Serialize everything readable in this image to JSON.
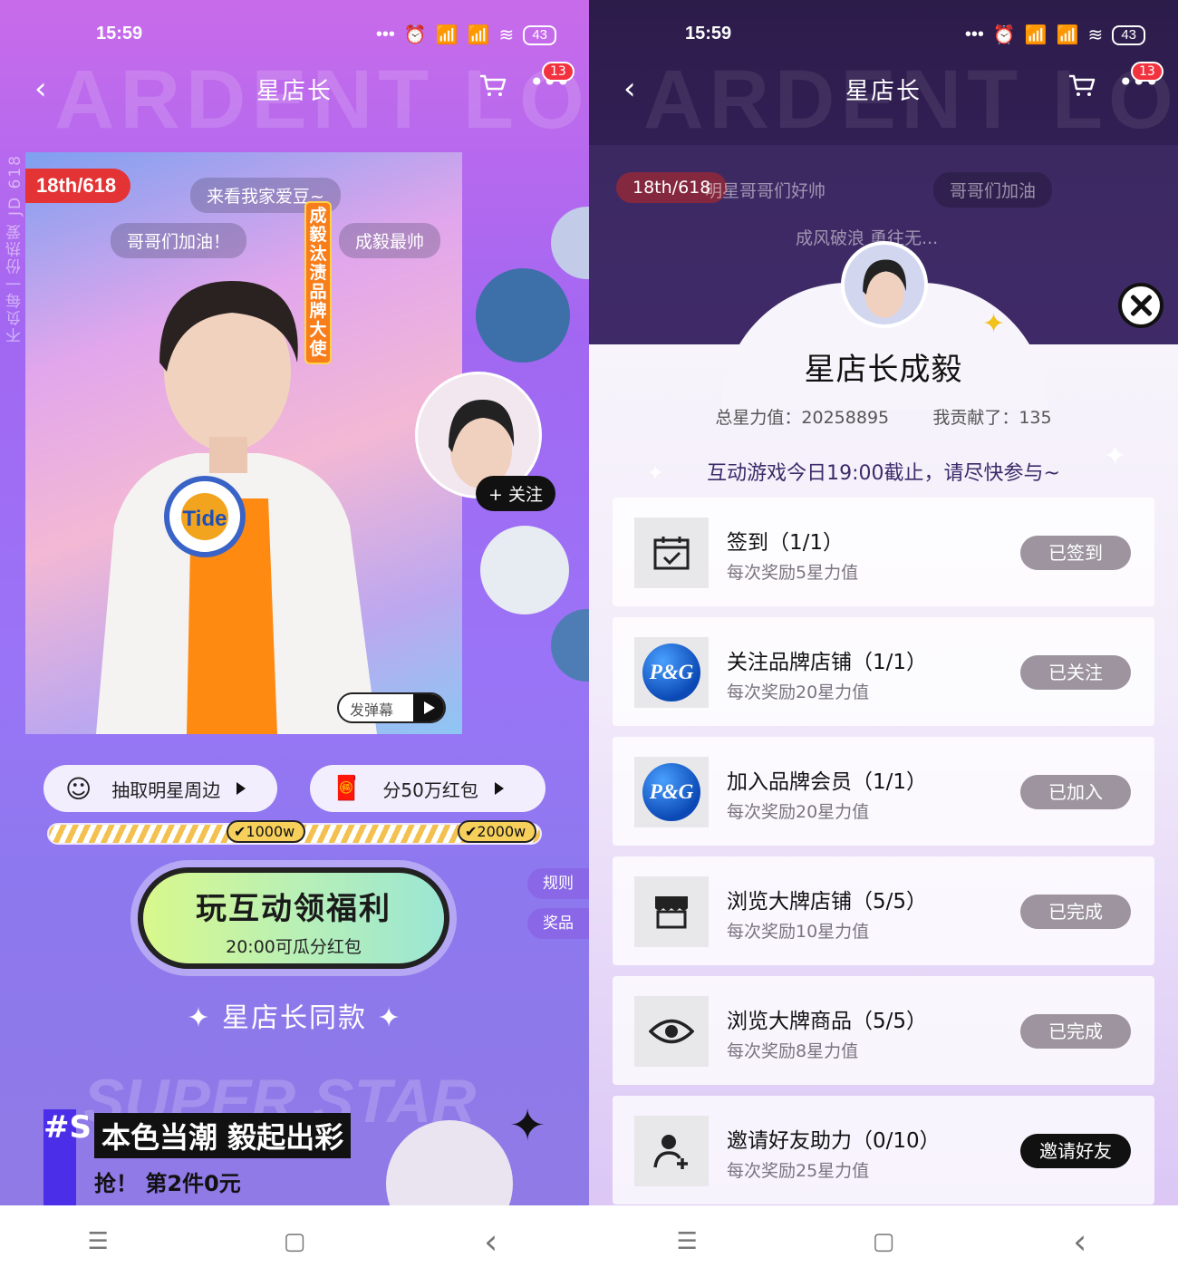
{
  "left": {
    "status": {
      "time": "15:59",
      "battery": "43",
      "signal_label": "HD"
    },
    "title": "星店长",
    "cart_badge": "13",
    "bg_word": "ARDENT LOVE",
    "side_vertical": "不负每一份热爱 JD 618",
    "hero": {
      "tag": "18th/618",
      "danmu": [
        "来看我家爱豆~",
        "哥哥们加油！",
        "成毅最帅"
      ],
      "vertical_banner": "成毅汰渍品牌大使",
      "send_danmu": "发弹幕"
    },
    "follow_label": "+ 关注",
    "pills": [
      {
        "label": "抽取明星周边"
      },
      {
        "label": "分50万红包"
      }
    ],
    "progress": {
      "marks": [
        "1000w",
        "2000w"
      ]
    },
    "main_button": {
      "title": "玩互动领福利",
      "subtitle": "20:00可瓜分红包"
    },
    "side_buttons": [
      "规则",
      "奖品"
    ],
    "section_title": "星店长同款",
    "super_star": "SUPER STAR",
    "promo": {
      "headline": "本色当潮 毅起出彩",
      "sub": "抢！ 第2件0元",
      "hash": "#S"
    }
  },
  "right": {
    "status": {
      "time": "15:59",
      "battery": "43"
    },
    "title": "星店长",
    "cart_badge": "13",
    "dim_danmu": [
      "18th/618",
      "明星哥哥们好帅",
      "哥哥们加油",
      "成风破浪 勇往无..."
    ],
    "sheet": {
      "title": "星店长成毅",
      "stats": {
        "total_label": "总星力值：",
        "total": "20258895",
        "mine_label": "我贡献了：",
        "mine": "135"
      },
      "notice": "互动游戏今日19:00截止，请尽快参与~"
    },
    "tasks": [
      {
        "name": "签到（1/1）",
        "desc": "每次奖励5星力值",
        "button": "已签到",
        "icon": "calendar-check-icon"
      },
      {
        "name": "关注品牌店铺（1/1）",
        "desc": "每次奖励20星力值",
        "button": "已关注",
        "icon": "pg-logo-icon",
        "logo_text": "P&G"
      },
      {
        "name": "加入品牌会员（1/1）",
        "desc": "每次奖励20星力值",
        "button": "已加入",
        "icon": "pg-logo-icon",
        "logo_text": "P&G"
      },
      {
        "name": "浏览大牌店铺（5/5）",
        "desc": "每次奖励10星力值",
        "button": "已完成",
        "icon": "store-icon"
      },
      {
        "name": "浏览大牌商品（5/5）",
        "desc": "每次奖励8星力值",
        "button": "已完成",
        "icon": "eye-icon"
      },
      {
        "name": "邀请好友助力（0/10）",
        "desc": "每次奖励25星力值",
        "button": "邀请好友",
        "icon": "add-user-icon"
      }
    ]
  },
  "nav": {
    "menu": "☰",
    "home": "▢",
    "back": "‹"
  },
  "colors": {
    "accent_purple": "#9a74f6",
    "badge_red": "#f2333f",
    "done_button": "#9d949f",
    "pg_blue": "#0b49b5"
  }
}
